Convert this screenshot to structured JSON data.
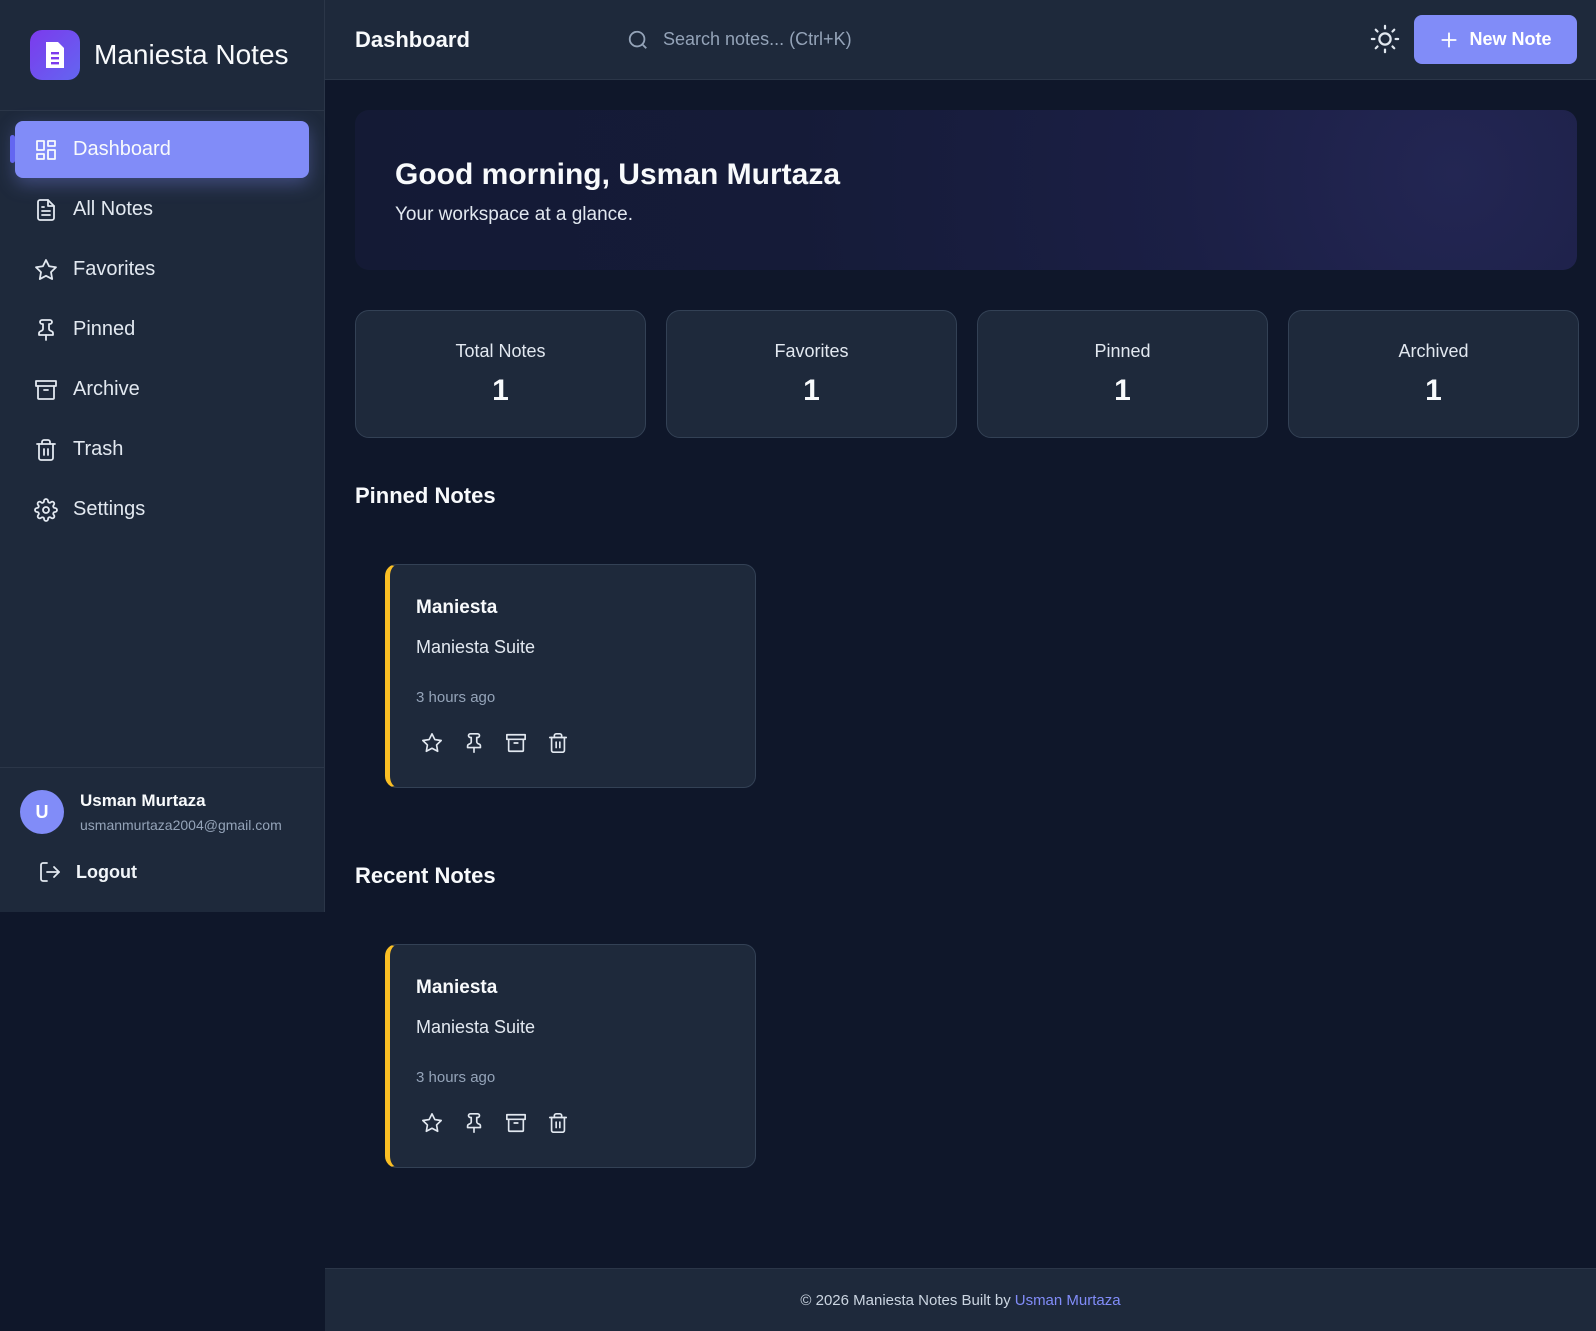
{
  "brand": {
    "title": "Maniesta Notes",
    "logo_icon": "document-icon"
  },
  "sidebar": {
    "items": [
      {
        "label": "Dashboard",
        "icon": "grid-icon",
        "active": true
      },
      {
        "label": "All Notes",
        "icon": "file-text-icon"
      },
      {
        "label": "Favorites",
        "icon": "star-icon"
      },
      {
        "label": "Pinned",
        "icon": "pin-icon"
      },
      {
        "label": "Archive",
        "icon": "archive-icon"
      },
      {
        "label": "Trash",
        "icon": "trash-icon"
      },
      {
        "label": "Settings",
        "icon": "gear-icon"
      }
    ],
    "user": {
      "initial": "U",
      "name": "Usman Murtaza",
      "email": "usmanmurtaza2004@gmail.com"
    },
    "logout_label": "Logout"
  },
  "header": {
    "title": "Dashboard",
    "search_placeholder": "Search notes... (Ctrl+K)",
    "new_note_label": "New Note"
  },
  "hero": {
    "greeting": "Good morning, Usman Murtaza",
    "subtitle": "Your workspace at a glance."
  },
  "stats": [
    {
      "label": "Total Notes",
      "value": "1"
    },
    {
      "label": "Favorites",
      "value": "1"
    },
    {
      "label": "Pinned",
      "value": "1"
    },
    {
      "label": "Archived",
      "value": "1"
    }
  ],
  "pinned": {
    "title": "Pinned Notes",
    "notes": [
      {
        "title": "Maniesta",
        "body": "Maniesta Suite",
        "time": "3 hours ago"
      }
    ]
  },
  "recent": {
    "title": "Recent Notes",
    "notes": [
      {
        "title": "Maniesta",
        "body": "Maniesta Suite",
        "time": "3 hours ago"
      }
    ]
  },
  "footer": {
    "text": "© 2026 Maniesta Notes Built by",
    "author": "Usman Murtaza"
  },
  "colors": {
    "accent": "#818cf8",
    "background": "#0f172a",
    "panel": "#1e293b",
    "note_border": "#fbbf24"
  }
}
